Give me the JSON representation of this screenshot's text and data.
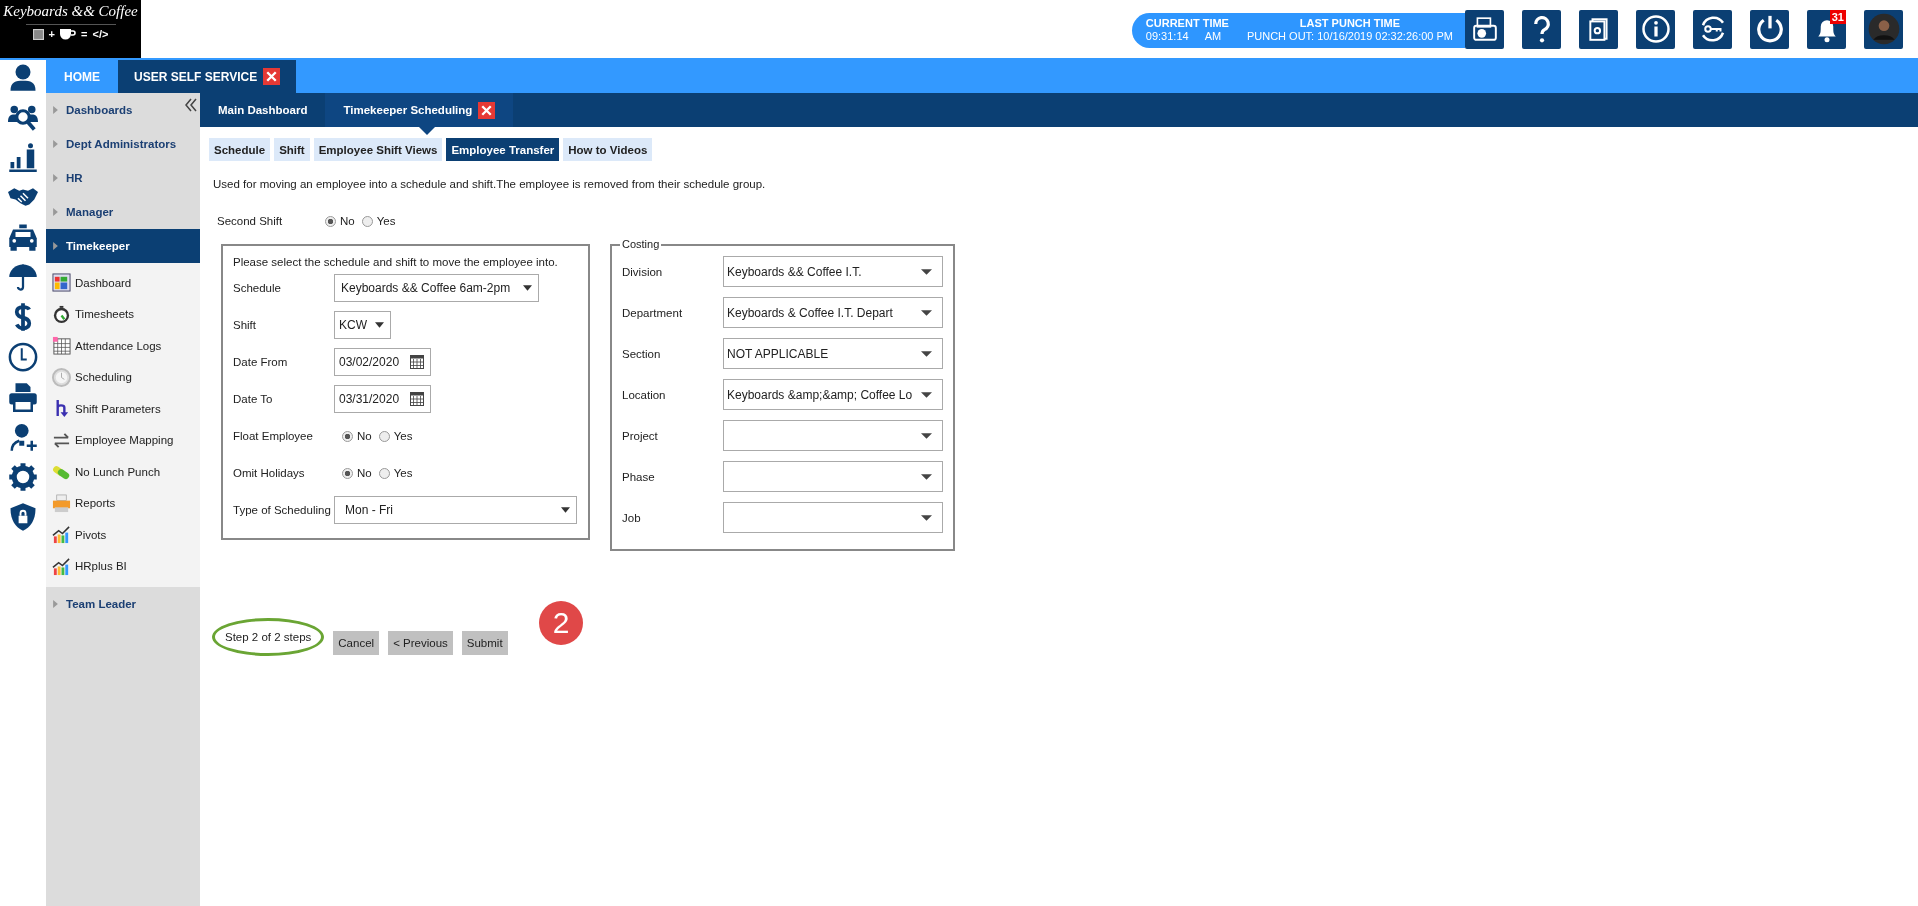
{
  "logo": {
    "title": "Keyboards && Coffee",
    "tagline": [
      "+",
      "=",
      "</>"
    ]
  },
  "time_panel": {
    "current_label": "CURRENT TIME",
    "current_time": "09:31:14",
    "current_ampm": "AM",
    "last_label": "LAST PUNCH TIME",
    "last_punch": "PUNCH OUT: 10/16/2019 02:32:26:00 PM"
  },
  "toolbar": [
    {
      "kind": "punch-clock"
    },
    {
      "kind": "help"
    },
    {
      "kind": "settings-book"
    },
    {
      "kind": "info"
    },
    {
      "kind": "key-refresh"
    },
    {
      "kind": "power"
    },
    {
      "kind": "bell",
      "badge": "31"
    },
    {
      "kind": "avatar"
    }
  ],
  "side_icons": [
    {
      "kind": "person"
    },
    {
      "kind": "people-search"
    },
    {
      "kind": "chart-person"
    },
    {
      "kind": "handshake"
    },
    {
      "kind": "car"
    },
    {
      "kind": "umbrella"
    },
    {
      "kind": "dollar"
    },
    {
      "kind": "clock"
    },
    {
      "kind": "printer"
    },
    {
      "kind": "person-add"
    },
    {
      "kind": "gear"
    },
    {
      "kind": "shield-lock"
    }
  ],
  "nav_tabs": [
    {
      "label": "HOME",
      "selected": false,
      "closable": false
    },
    {
      "label": "USER SELF SERVICE",
      "selected": true,
      "closable": true
    }
  ],
  "menu": [
    {
      "label": "Dashboards",
      "selected": false
    },
    {
      "label": "Dept Administrators",
      "selected": false
    },
    {
      "label": "HR",
      "selected": false
    },
    {
      "label": "Manager",
      "selected": false
    },
    {
      "label": "Timekeeper",
      "selected": true,
      "children": [
        {
          "label": "Dashboard",
          "kind": "dashboard"
        },
        {
          "label": "Timesheets",
          "kind": "stopwatch"
        },
        {
          "label": "Attendance Logs",
          "kind": "calendar"
        },
        {
          "label": "Scheduling",
          "kind": "clock"
        },
        {
          "label": "Shift Parameters",
          "kind": "shift"
        },
        {
          "label": "Employee Mapping",
          "kind": "swap"
        },
        {
          "label": "No Lunch Punch",
          "kind": "pill"
        },
        {
          "label": "Reports",
          "kind": "printer"
        },
        {
          "label": "Pivots",
          "kind": "chart"
        },
        {
          "label": "HRplus BI",
          "kind": "chart"
        }
      ]
    },
    {
      "label": "Team Leader",
      "selected": false
    }
  ],
  "sub_tabs": [
    {
      "label": "Main Dashboard",
      "selected": false,
      "closable": false
    },
    {
      "label": "Timekeeper Scheduling",
      "selected": true,
      "closable": true
    }
  ],
  "page_tabs": [
    {
      "label": "Schedule",
      "selected": false
    },
    {
      "label": "Shift",
      "selected": false
    },
    {
      "label": "Employee Shift Views",
      "selected": false
    },
    {
      "label": "Employee Transfer",
      "selected": true
    },
    {
      "label": "How to Videos",
      "selected": false
    }
  ],
  "description": "Used for moving an employee into a schedule and shift.The employee is removed from their schedule group.",
  "second_shift": {
    "label": "Second Shift",
    "options": [
      {
        "label": "No",
        "selected": true
      },
      {
        "label": "Yes",
        "selected": false
      }
    ]
  },
  "schedule_form": {
    "instruction": "Please select the schedule and shift to move the employee into.",
    "fields": [
      {
        "label": "Schedule",
        "kind": "select",
        "value": "Keyboards && Coffee 6am-2pm"
      },
      {
        "label": "Shift",
        "kind": "select",
        "value": "KCW"
      },
      {
        "label": "Date From",
        "kind": "date",
        "value": "03/02/2020"
      },
      {
        "label": "Date To",
        "kind": "date",
        "value": "03/31/2020"
      },
      {
        "label": "Float Employee",
        "kind": "radio",
        "options": [
          {
            "label": "No",
            "selected": true
          },
          {
            "label": "Yes",
            "selected": false
          }
        ]
      },
      {
        "label": "Omit Holidays",
        "kind": "radio",
        "options": [
          {
            "label": "No",
            "selected": true
          },
          {
            "label": "Yes",
            "selected": false
          }
        ]
      },
      {
        "label": "Type of Scheduling",
        "kind": "select",
        "value": "Mon - Fri"
      }
    ]
  },
  "costing": {
    "legend": "Costing",
    "fields": [
      {
        "label": "Division",
        "value": "Keyboards && Coffee I.T."
      },
      {
        "label": "Department",
        "value": "Keyboards & Coffee I.T. Depart"
      },
      {
        "label": "Section",
        "value": "NOT APPLICABLE"
      },
      {
        "label": "Location",
        "value": "Keyboards &amp;&amp; Coffee Lo"
      },
      {
        "label": "Project"
      },
      {
        "label": "Phase"
      },
      {
        "label": "Job"
      }
    ]
  },
  "steps": {
    "text": "Step 2 of 2 steps",
    "buttons": [
      "Cancel",
      "< Previous",
      "Submit"
    ],
    "marker": "2"
  }
}
